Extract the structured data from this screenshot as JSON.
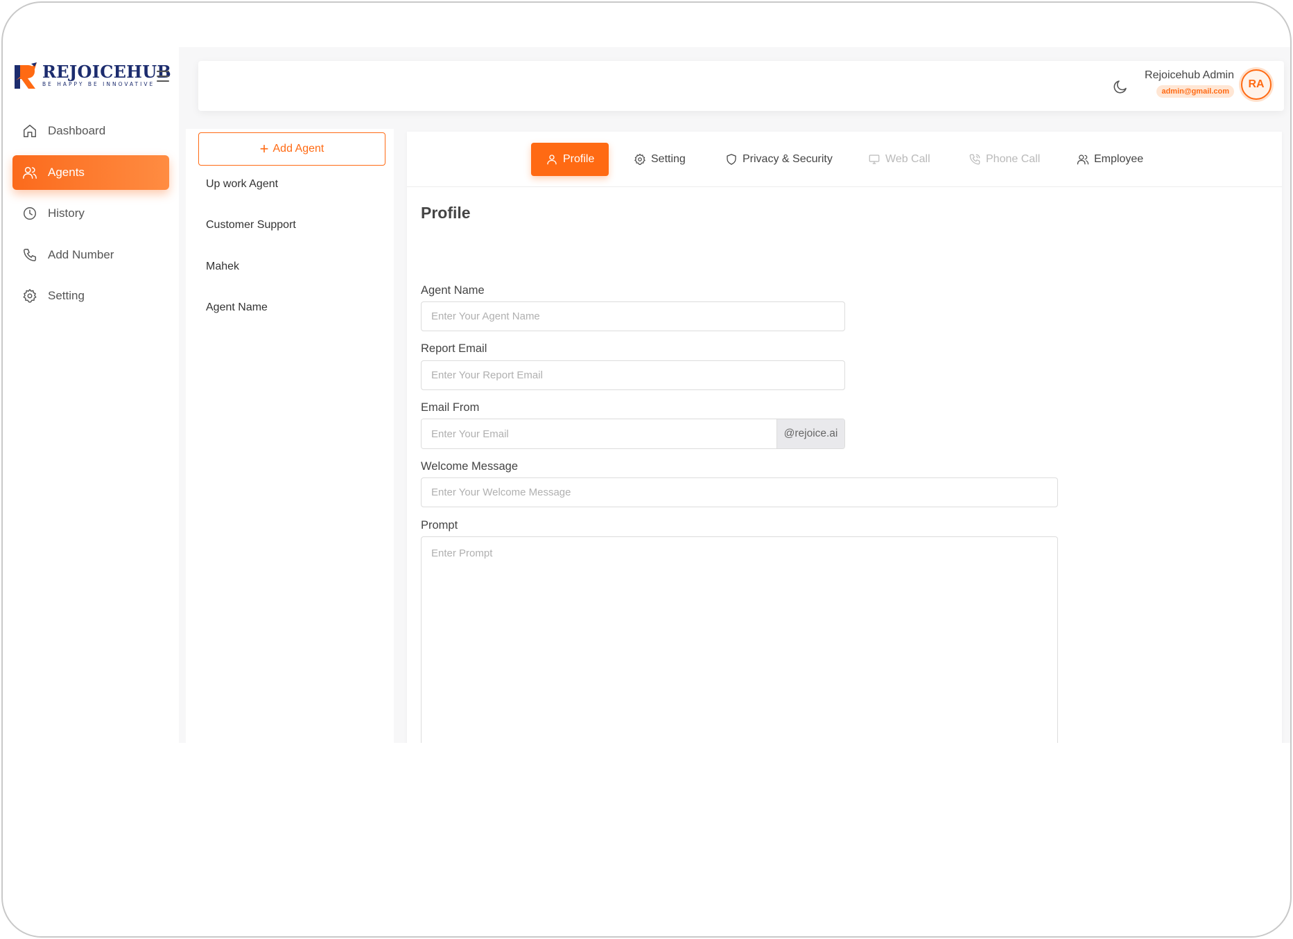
{
  "brand": {
    "name": "REJOICEHUB",
    "tagline": "BE HAPPY BE INNOVATIVE",
    "accent": "#ff6a13",
    "navy": "#1c2c6e"
  },
  "sidebar": {
    "items": [
      {
        "label": "Dashboard",
        "icon": "home-icon",
        "active": false
      },
      {
        "label": "Agents",
        "icon": "users-icon",
        "active": true
      },
      {
        "label": "History",
        "icon": "clock-icon",
        "active": false
      },
      {
        "label": "Add Number",
        "icon": "phone-icon",
        "active": false
      },
      {
        "label": "Setting",
        "icon": "gear-icon",
        "active": false
      }
    ]
  },
  "header": {
    "user_name": "Rejoicehub Admin",
    "user_email": "admin@gmail.com",
    "avatar_initials": "RA",
    "theme_icon": "moon-icon"
  },
  "agents": {
    "add_label": "Add Agent",
    "list": [
      "Up work Agent",
      "Customer Support",
      "Mahek",
      "Agent Name"
    ]
  },
  "tabs": [
    {
      "label": "Profile",
      "icon": "user-icon",
      "state": "active"
    },
    {
      "label": "Setting",
      "icon": "gear-icon",
      "state": "normal"
    },
    {
      "label": "Privacy & Security",
      "icon": "shield-icon",
      "state": "normal"
    },
    {
      "label": "Web Call",
      "icon": "monitor-icon",
      "state": "disabled"
    },
    {
      "label": "Phone Call",
      "icon": "phone-call-icon",
      "state": "disabled"
    },
    {
      "label": "Employee",
      "icon": "users-icon",
      "state": "normal"
    }
  ],
  "profile": {
    "title": "Profile",
    "agent_name": {
      "label": "Agent Name",
      "placeholder": "Enter Your Agent Name",
      "value": ""
    },
    "report_email": {
      "label": "Report Email",
      "placeholder": "Enter Your Report Email",
      "value": ""
    },
    "email_from": {
      "label": "Email From",
      "placeholder": "Enter Your Email",
      "suffix": "@rejoice.ai",
      "value": ""
    },
    "welcome_message": {
      "label": "Welcome Message",
      "placeholder": "Enter Your Welcome Message",
      "value": ""
    },
    "prompt": {
      "label": "Prompt",
      "placeholder": "Enter Prompt",
      "value": ""
    }
  }
}
